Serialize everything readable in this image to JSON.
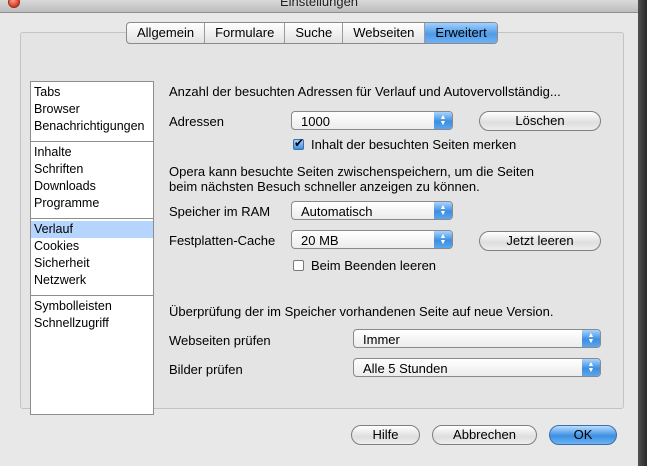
{
  "window": {
    "title": "Einstellungen"
  },
  "tabs": [
    {
      "label": "Allgemein"
    },
    {
      "label": "Formulare"
    },
    {
      "label": "Suche"
    },
    {
      "label": "Webseiten"
    },
    {
      "label": "Erweitert",
      "active": true
    }
  ],
  "sidebar": {
    "groups": [
      [
        "Tabs",
        "Browser",
        "Benachrichtigungen"
      ],
      [
        "Inhalte",
        "Schriften",
        "Downloads",
        "Programme"
      ],
      [
        "Verlauf",
        "Cookies",
        "Sicherheit",
        "Netzwerk"
      ],
      [
        "Symbolleisten",
        "Schnellzugriff"
      ]
    ],
    "selected": "Verlauf"
  },
  "history": {
    "heading": "Anzahl der besuchten Adressen für Verlauf und Autovervollständig...",
    "addresses_label": "Adressen",
    "addresses_value": "1000",
    "clear_button": "Löschen",
    "remember_checkbox": "Inhalt der besuchten Seiten merken",
    "remember_checked": true
  },
  "cache": {
    "description_line1": "Opera kann besuchte Seiten zwischenspeichern, um die Seiten",
    "description_line2": "beim nächsten Besuch schneller anzeigen zu können.",
    "ram_label": "Speicher im RAM",
    "ram_value": "Automatisch",
    "disk_label": "Festplatten-Cache",
    "disk_value": "20 MB",
    "empty_now_button": "Jetzt leeren",
    "empty_on_exit_checkbox": "Beim Beenden leeren",
    "empty_on_exit_checked": false
  },
  "check": {
    "heading": "Überprüfung der im Speicher vorhandenen Seite auf neue Version.",
    "pages_label": "Webseiten prüfen",
    "pages_value": "Immer",
    "images_label": "Bilder prüfen",
    "images_value": "Alle 5 Stunden"
  },
  "footer": {
    "help": "Hilfe",
    "cancel": "Abbrechen",
    "ok": "OK"
  },
  "colors": {
    "accent": "#4f9be8",
    "selection": "#b5d5ff",
    "close": "#d33b25"
  }
}
